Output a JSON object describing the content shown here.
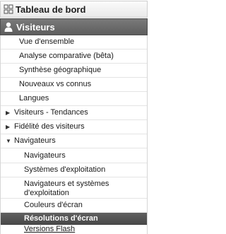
{
  "nav": {
    "dashboard_label": "Tableau de bord",
    "section_label": "Visiteurs",
    "items": [
      {
        "label": "Vue d'ensemble"
      },
      {
        "label": "Analyse comparative (bêta)"
      },
      {
        "label": "Synthèse géographique"
      },
      {
        "label": "Nouveaux vs connus"
      },
      {
        "label": "Langues"
      },
      {
        "label": "Visiteurs - Tendances",
        "expand_glyph": "▶"
      },
      {
        "label": "Fidélité des visiteurs",
        "expand_glyph": "▶"
      },
      {
        "label": "Navigateurs",
        "expand_glyph": "▼"
      }
    ],
    "sub_items": [
      {
        "label": "Navigateurs"
      },
      {
        "label": "Systèmes d'exploitation"
      },
      {
        "label": "Navigateurs et systèmes d'exploitation"
      },
      {
        "label": "Couleurs d'écran"
      },
      {
        "label": "Résolutions d'écran",
        "selected": true
      },
      {
        "label": "Versions Flash"
      }
    ]
  },
  "colors": {
    "selected_bg": "#555555",
    "section_bg": "#6b6b6b"
  }
}
